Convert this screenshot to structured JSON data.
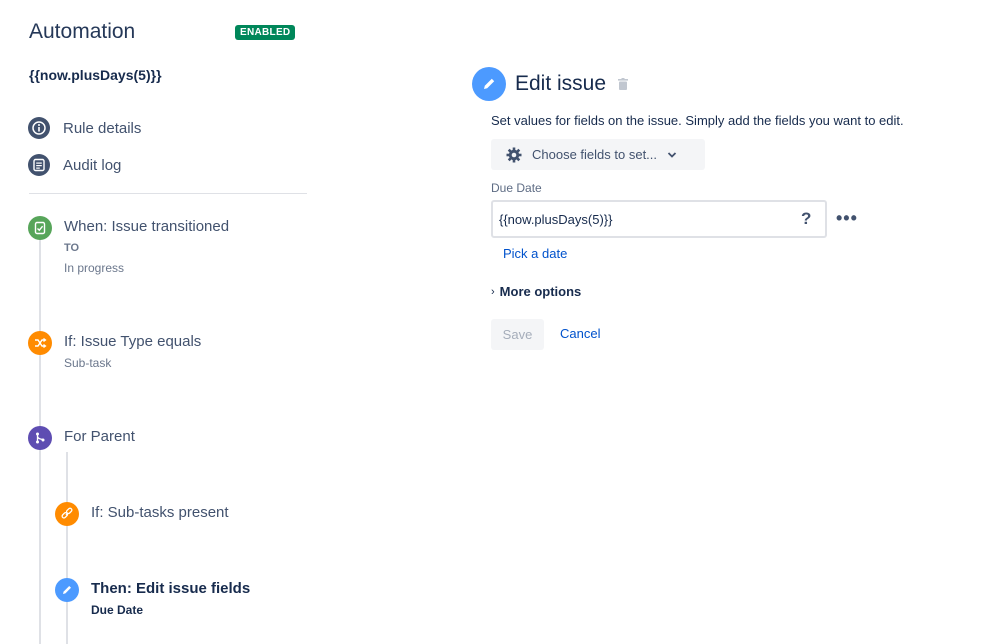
{
  "sidebar": {
    "title": "Automation",
    "status_badge": "ENABLED",
    "rule_name": "{{now.plusDays(5)}}",
    "nav": [
      {
        "label": "Rule details",
        "icon": "info-icon"
      },
      {
        "label": "Audit log",
        "icon": "list-icon"
      }
    ],
    "components": [
      {
        "title": "When: Issue transitioned",
        "sub1": "TO",
        "sub2": "In progress",
        "icon": "trigger-icon",
        "color": "#57a55a"
      },
      {
        "title": "If: Issue Type equals",
        "sub1": "Sub-task",
        "icon": "shuffle-icon",
        "color": "#ff8b00"
      },
      {
        "title": "For Parent",
        "icon": "branch-icon",
        "color": "#5e4db2"
      },
      {
        "title": "If: Sub-tasks present",
        "icon": "link-icon",
        "color": "#ff8b00"
      },
      {
        "title": "Then: Edit issue fields",
        "sub1": "Due Date",
        "icon": "pencil-icon",
        "color": "#4c9aff"
      }
    ]
  },
  "editor": {
    "title": "Edit issue",
    "description": "Set values for fields on the issue. Simply add the fields you want to edit.",
    "choose_fields_label": "Choose fields to set...",
    "field_label": "Due Date",
    "field_value": "{{now.plusDays(5)}}",
    "help_label": "?",
    "more_dots": "•••",
    "pick_date_label": "Pick a date",
    "more_options_chevron": "›",
    "more_options_label": "More options",
    "save_label": "Save",
    "cancel_label": "Cancel"
  },
  "colors": {
    "enabled_badge": "#00875a",
    "link": "#0052cc",
    "edit_icon_bg": "#4c9aff"
  }
}
